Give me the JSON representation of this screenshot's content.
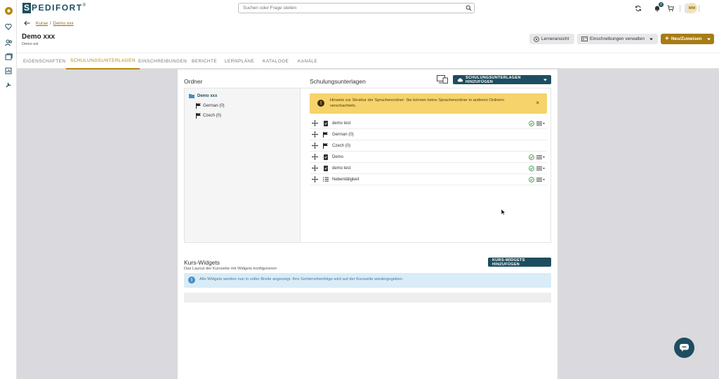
{
  "header": {
    "logo_letter": "S",
    "logo_text": "PEDIFORT",
    "logo_mark": "®",
    "search_placeholder": "Suchen oder Frage stellen",
    "notification_count": "0",
    "avatar_initials": "MM"
  },
  "breadcrumb": {
    "root": "Kurse",
    "sep": "/",
    "current": "Demo xxx"
  },
  "course": {
    "title": "Demo xxx",
    "subtitle": "Demo est",
    "learner_view": "Lerneransicht",
    "manage_enrollments": "Einschreibungen verwalten",
    "new_assign": "Neu/Zuweisen"
  },
  "tabs": [
    "EIGENSCHAFTEN",
    "SCHULUNGSUNTERLAGEN",
    "EINSCHREIBUNGEN",
    "BERICHTE",
    "LERNPLÄNE",
    "KATALOGE",
    "KANÄLE"
  ],
  "folders": {
    "title": "Ordner",
    "root": "Demo xxx",
    "items": [
      "German (0)",
      "Czech (0)"
    ]
  },
  "materials": {
    "title": "Schulungsunterlagen",
    "add_button": "SCHULUNGSUNTERLAGEN HINZUFÜGEN",
    "warning": "Hinweis zur Struktur der Sprachenordner: Sie können keine Sprachenordner in anderen Ordnern verschachteln.",
    "rows": [
      {
        "label": "demo test",
        "type": "doc",
        "status": true
      },
      {
        "label": "German (0)",
        "type": "flag",
        "status": false
      },
      {
        "label": "Czech (0)",
        "type": "flag",
        "status": false
      },
      {
        "label": "Demo",
        "type": "doc",
        "status": true
      },
      {
        "label": "demo test",
        "type": "doc",
        "status": true
      },
      {
        "label": "Nebentätigkeit",
        "type": "list",
        "status": true
      }
    ]
  },
  "widgets": {
    "title": "Kurs-Widgets",
    "subtitle": "Das Layout der Kursseite mit Widgets konfigurieren",
    "add_button": "KURS-WIDGETS HINZUFÜGEN",
    "info": "Alle Widgets werden nun in voller Breite angezeigt. Ihre Sortierreihenfolge wird auf der Kursseite wiedergegeben."
  },
  "colors": {
    "brand": "#1d4e5f",
    "accent": "#b8860b",
    "warning": "#f6d36b",
    "info": "#d9ecf7"
  }
}
